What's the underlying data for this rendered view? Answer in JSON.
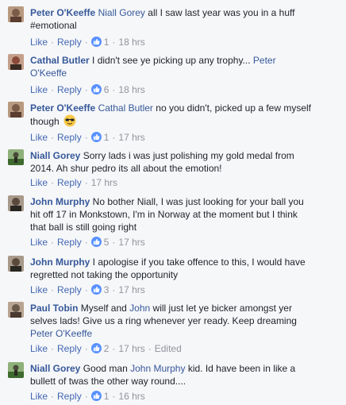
{
  "actions": {
    "like": "Like",
    "reply": "Reply",
    "sep": "·"
  },
  "colors": {
    "link": "#365899",
    "action": "#4267b2",
    "meta": "#90949c",
    "like_badge": "#5890ff"
  },
  "comments": [
    {
      "author": "Peter O'Keeffe",
      "tag": "Niall Gorey",
      "text": "all I saw last year was you in a huff #emotional",
      "likes": "1",
      "time": "18 hrs",
      "avatar_color": "#7a5c4a"
    },
    {
      "author": "Cathal Butler",
      "text": "I didn't see ye picking up any trophy...",
      "tag_after": "Peter O'Keeffe",
      "likes": "6",
      "time": "18 hrs",
      "avatar_color": "#8a4a3a"
    },
    {
      "author": "Peter O'Keeffe",
      "tag": "Cathal Butler",
      "text": "no you didn't, picked up a few myself though",
      "emoji": "sunglasses-emoji",
      "likes": "1",
      "time": "17 hrs",
      "avatar_color": "#7a5c4a"
    },
    {
      "author": "Niall Gorey",
      "text": "Sorry lads i was just polishing my gold medal from 2014. Ah shur pedro its all about the emotion!",
      "time": "17 hrs",
      "avatar_color": "#4a6a3a"
    },
    {
      "author": "John Murphy",
      "text": "No bother Niall, I was just looking for your ball you hit off 17 in Monkstown, I'm in Norway at the moment but I think that ball is still going right",
      "likes": "5",
      "time": "17 hrs",
      "avatar_color": "#5a4a3e"
    },
    {
      "author": "John Murphy",
      "text": "I apologise if you take offence to this, I would have regretted not taking the opportunity",
      "likes": "3",
      "time": "17 hrs",
      "avatar_color": "#5a4a3e"
    },
    {
      "author": "Paul Tobin",
      "text_before_tag": "Myself and",
      "mid_tag": "John",
      "text": "will just let ye bicker amongst yer selves lads! Give us a ring whenever yer ready. Keep dreaming",
      "tag_after": "Peter O'Keeffe",
      "likes": "2",
      "time": "17 hrs",
      "edited": "Edited",
      "avatar_color": "#6a5a4a"
    },
    {
      "author": "Niall Gorey",
      "text_before_tag": "Good man",
      "mid_tag": "John Murphy",
      "text": "kid. Id have been in like a bullett of twas the other way round....",
      "likes": "1",
      "time": "16 hrs",
      "avatar_color": "#4a6a3a"
    }
  ]
}
